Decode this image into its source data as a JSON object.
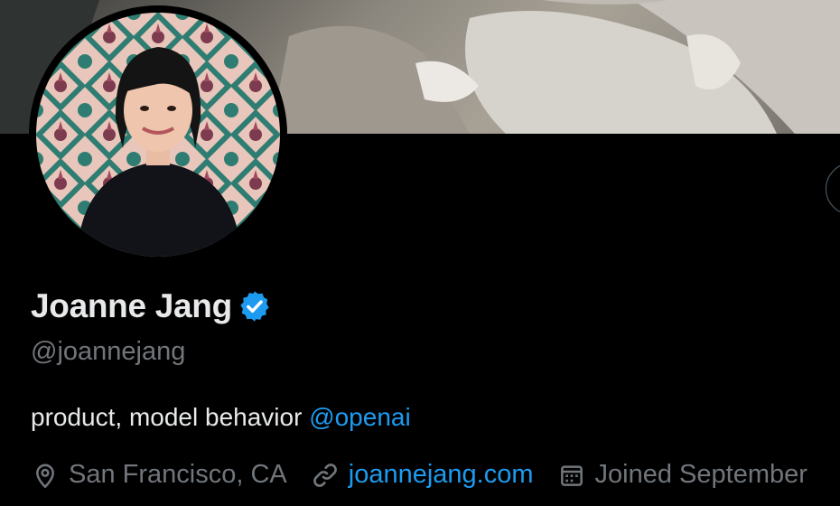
{
  "profile": {
    "display_name": "Joanne Jang",
    "verified_icon": "verified-badge-icon",
    "handle": "@joannejang",
    "bio_text": "product, model behavior ",
    "bio_mention": "@openai",
    "location": "San Francisco, CA",
    "website": "joannejang.com",
    "joined": "Joined September"
  },
  "icons": {
    "location": "location-pin-icon",
    "website": "link-icon",
    "joined": "calendar-icon"
  },
  "colors": {
    "background": "#000000",
    "primary_text": "#e7e9ea",
    "secondary_text": "#71767b",
    "accent": "#1d9bf0"
  }
}
